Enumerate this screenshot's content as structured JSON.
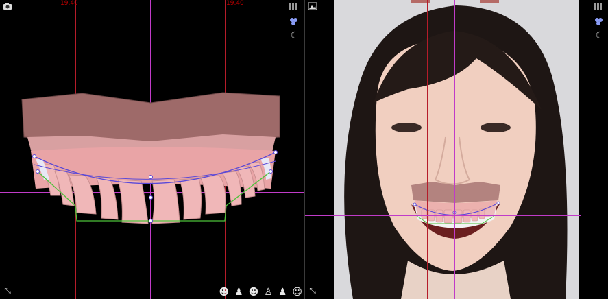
{
  "left_view": {
    "ruler_left": "19,40",
    "ruler_right": "19,40",
    "icons": {
      "top_left": "camera-icon",
      "top_right": [
        "grid-icon",
        "tooth-group-icon",
        "moon-icon"
      ],
      "bottom_left": "resize-icon",
      "bottom_right": [
        "profile-left-icon",
        "bust-front-icon",
        "profile-right-icon",
        "bust-top-icon",
        "bust-bottom-icon",
        "profile-bust-icon"
      ]
    }
  },
  "right_view": {
    "icons": {
      "top_left": "image-icon",
      "top_right": [
        "grid-icon",
        "tooth-group-icon",
        "moon-icon"
      ]
    }
  },
  "colors": {
    "guide_red": "#b51c2a",
    "guide_magenta": "#c03bc8",
    "gum": "#e9a4a6",
    "tray": "#9e6a69",
    "smile_curve": "#5a49d8",
    "edge_line": "#4cc23a"
  }
}
